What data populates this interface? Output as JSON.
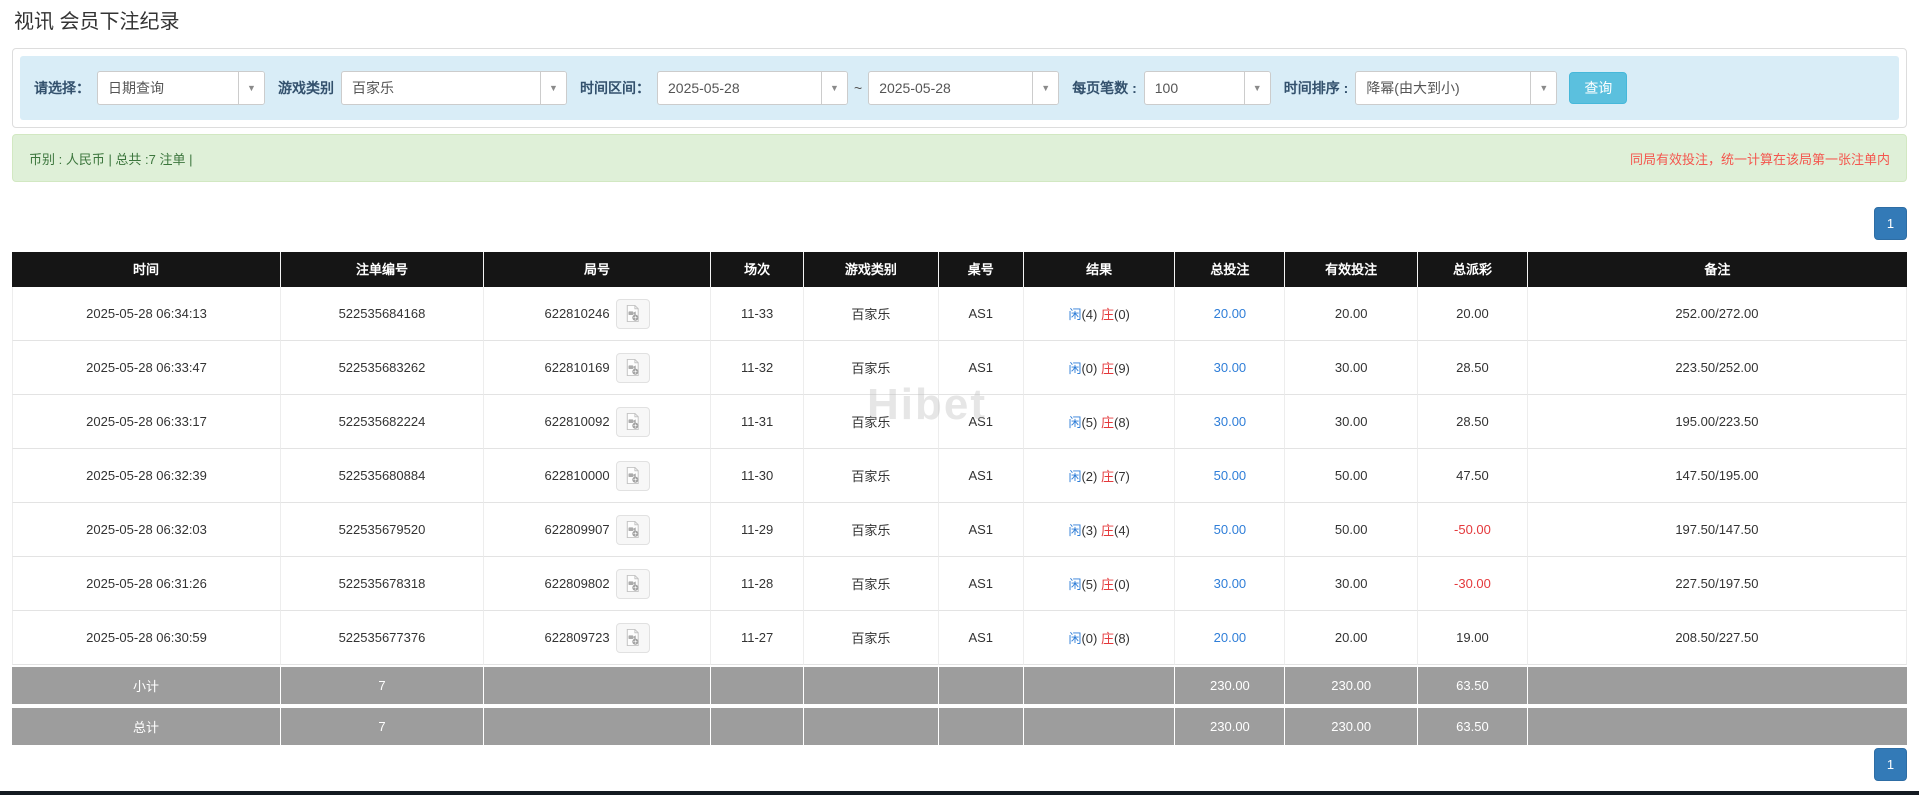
{
  "page": {
    "title": "视讯 会员下注纪录",
    "watermark": "Hibet"
  },
  "filter_bar": {
    "select_type": {
      "label": "请选择：",
      "value": "日期查询"
    },
    "game_type": {
      "label": "游戏类别",
      "value": "百家乐"
    },
    "time_range": {
      "label": "时间区间：",
      "from": "2025-05-28",
      "separator": "~",
      "to": "2025-05-28"
    },
    "page_size": {
      "label": "每页笔数 :",
      "value": "100"
    },
    "time_sort": {
      "label": "时间排序 :",
      "value": "降幂(由大到小)"
    },
    "search_button": "查询"
  },
  "summary_bar": {
    "currency_info": "币别 : 人民币 | 总共 :7 注单 |",
    "notice": "同局有效投注，统一计算在该局第一张注单内"
  },
  "pagination": {
    "current_page": "1"
  },
  "colors": {
    "accent_blue": "#2f7ed8",
    "banker_red": "#e4393c",
    "button_cyan": "#5bc0de",
    "header_black": "#151515",
    "subtotal_gray": "#9d9d9d",
    "success_bg": "#dff0d8",
    "info_bg": "#d9edf7",
    "active_page_blue": "#337ab7"
  },
  "table": {
    "headers": [
      "时间",
      "注单编号",
      "局号",
      "场次",
      "游戏类别",
      "桌号",
      "结果",
      "总投注",
      "有效投注",
      "总派彩",
      "备注"
    ],
    "rows": [
      {
        "time": "2025-05-28 06:34:13",
        "bet_id": "522535684168",
        "round_id": "622810246",
        "session": "11-33",
        "game_type": "百家乐",
        "table_no": "AS1",
        "result": {
          "player": "闲",
          "player_count": "(4)",
          "banker": "庄",
          "banker_count": "(0)"
        },
        "total_bet": "20.00",
        "valid_bet": "20.00",
        "total_payout": "20.00",
        "payout_negative": false,
        "remark": "252.00/272.00"
      },
      {
        "time": "2025-05-28 06:33:47",
        "bet_id": "522535683262",
        "round_id": "622810169",
        "session": "11-32",
        "game_type": "百家乐",
        "table_no": "AS1",
        "result": {
          "player": "闲",
          "player_count": "(0)",
          "banker": "庄",
          "banker_count": "(9)"
        },
        "total_bet": "30.00",
        "valid_bet": "30.00",
        "total_payout": "28.50",
        "payout_negative": false,
        "remark": "223.50/252.00"
      },
      {
        "time": "2025-05-28 06:33:17",
        "bet_id": "522535682224",
        "round_id": "622810092",
        "session": "11-31",
        "game_type": "百家乐",
        "table_no": "AS1",
        "result": {
          "player": "闲",
          "player_count": "(5)",
          "banker": "庄",
          "banker_count": "(8)"
        },
        "total_bet": "30.00",
        "valid_bet": "30.00",
        "total_payout": "28.50",
        "payout_negative": false,
        "remark": "195.00/223.50"
      },
      {
        "time": "2025-05-28 06:32:39",
        "bet_id": "522535680884",
        "round_id": "622810000",
        "session": "11-30",
        "game_type": "百家乐",
        "table_no": "AS1",
        "result": {
          "player": "闲",
          "player_count": "(2)",
          "banker": "庄",
          "banker_count": "(7)"
        },
        "total_bet": "50.00",
        "valid_bet": "50.00",
        "total_payout": "47.50",
        "payout_negative": false,
        "remark": "147.50/195.00"
      },
      {
        "time": "2025-05-28 06:32:03",
        "bet_id": "522535679520",
        "round_id": "622809907",
        "session": "11-29",
        "game_type": "百家乐",
        "table_no": "AS1",
        "result": {
          "player": "闲",
          "player_count": "(3)",
          "banker": "庄",
          "banker_count": "(4)"
        },
        "total_bet": "50.00",
        "valid_bet": "50.00",
        "total_payout": "-50.00",
        "payout_negative": true,
        "remark": "197.50/147.50"
      },
      {
        "time": "2025-05-28 06:31:26",
        "bet_id": "522535678318",
        "round_id": "622809802",
        "session": "11-28",
        "game_type": "百家乐",
        "table_no": "AS1",
        "result": {
          "player": "闲",
          "player_count": "(5)",
          "banker": "庄",
          "banker_count": "(0)"
        },
        "total_bet": "30.00",
        "valid_bet": "30.00",
        "total_payout": "-30.00",
        "payout_negative": true,
        "remark": "227.50/197.50"
      },
      {
        "time": "2025-05-28 06:30:59",
        "bet_id": "522535677376",
        "round_id": "622809723",
        "session": "11-27",
        "game_type": "百家乐",
        "table_no": "AS1",
        "result": {
          "player": "闲",
          "player_count": "(0)",
          "banker": "庄",
          "banker_count": "(8)"
        },
        "total_bet": "20.00",
        "valid_bet": "20.00",
        "total_payout": "19.00",
        "payout_negative": false,
        "remark": "208.50/227.50"
      }
    ],
    "subtotal": {
      "label": "小计",
      "count": "7",
      "total_bet": "230.00",
      "valid_bet": "230.00",
      "total_payout": "63.50"
    },
    "grand_total": {
      "label": "总计",
      "count": "7",
      "total_bet": "230.00",
      "valid_bet": "230.00",
      "total_payout": "63.50"
    }
  }
}
